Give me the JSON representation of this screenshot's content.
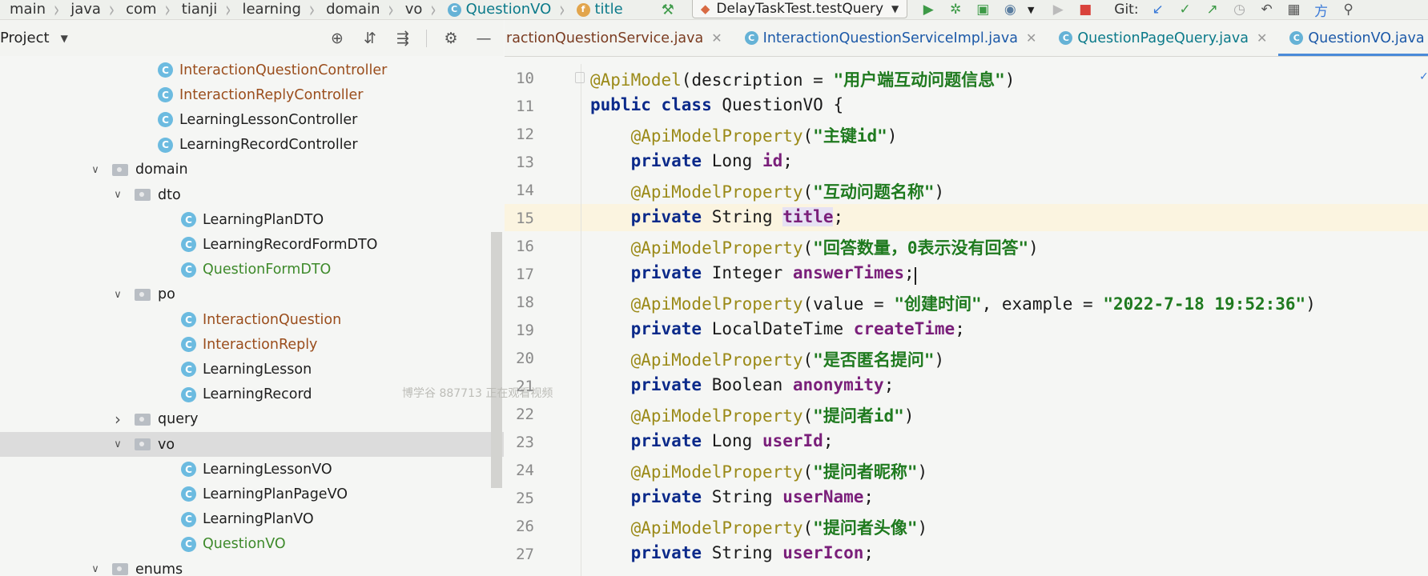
{
  "breadcrumb": [
    {
      "label": "main",
      "type": "dir"
    },
    {
      "label": "java",
      "type": "dir"
    },
    {
      "label": "com",
      "type": "dir"
    },
    {
      "label": "tianji",
      "type": "dir"
    },
    {
      "label": "learning",
      "type": "dir"
    },
    {
      "label": "domain",
      "type": "dir"
    },
    {
      "label": "vo",
      "type": "dir"
    },
    {
      "label": "QuestionVO",
      "type": "class"
    },
    {
      "label": "title",
      "type": "field"
    }
  ],
  "toolbar": {
    "run_config": "DelayTaskTest.testQuery",
    "git_label": "Git:"
  },
  "project_panel": {
    "title": "Project",
    "tree": [
      {
        "label": "InteractionQuestionController",
        "kind": "class",
        "depth": 3,
        "status": "modified"
      },
      {
        "label": "InteractionReplyController",
        "kind": "class",
        "depth": 3,
        "status": "modified"
      },
      {
        "label": "LearningLessonController",
        "kind": "class",
        "depth": 3,
        "status": "default"
      },
      {
        "label": "LearningRecordController",
        "kind": "class",
        "depth": 3,
        "status": "default"
      },
      {
        "label": "domain",
        "kind": "folder",
        "depth": 1,
        "expanded": true,
        "status": "default"
      },
      {
        "label": "dto",
        "kind": "folder",
        "depth": 2,
        "expanded": true,
        "status": "default"
      },
      {
        "label": "LearningPlanDTO",
        "kind": "class",
        "depth": 4,
        "status": "default"
      },
      {
        "label": "LearningRecordFormDTO",
        "kind": "class",
        "depth": 4,
        "status": "default"
      },
      {
        "label": "QuestionFormDTO",
        "kind": "class",
        "depth": 4,
        "status": "new"
      },
      {
        "label": "po",
        "kind": "folder",
        "depth": 2,
        "expanded": true,
        "status": "default"
      },
      {
        "label": "InteractionQuestion",
        "kind": "class",
        "depth": 4,
        "status": "modified"
      },
      {
        "label": "InteractionReply",
        "kind": "class",
        "depth": 4,
        "status": "modified"
      },
      {
        "label": "LearningLesson",
        "kind": "class",
        "depth": 4,
        "status": "default"
      },
      {
        "label": "LearningRecord",
        "kind": "class",
        "depth": 4,
        "status": "default"
      },
      {
        "label": "query",
        "kind": "folder",
        "depth": 2,
        "expanded": false,
        "status": "default"
      },
      {
        "label": "vo",
        "kind": "folder",
        "depth": 2,
        "expanded": true,
        "status": "default",
        "selected": true
      },
      {
        "label": "LearningLessonVO",
        "kind": "class",
        "depth": 4,
        "status": "default"
      },
      {
        "label": "LearningPlanPageVO",
        "kind": "class",
        "depth": 4,
        "status": "default"
      },
      {
        "label": "LearningPlanVO",
        "kind": "class",
        "depth": 4,
        "status": "default"
      },
      {
        "label": "QuestionVO",
        "kind": "class",
        "depth": 4,
        "status": "new"
      },
      {
        "label": "enums",
        "kind": "folder",
        "depth": 1,
        "expanded": true,
        "status": "default"
      }
    ]
  },
  "watermark": "博学谷 887713 正在观看视频",
  "editor": {
    "tabs": [
      {
        "label": "ractionQuestionService.java",
        "icon": false,
        "closable": true,
        "style": "first"
      },
      {
        "label": "InteractionQuestionServiceImpl.java",
        "icon": true,
        "closable": true,
        "style": "plain"
      },
      {
        "label": "QuestionPageQuery.java",
        "icon": true,
        "closable": true,
        "style": "mod"
      },
      {
        "label": "QuestionVO.java",
        "icon": true,
        "closable": true,
        "style": "active"
      }
    ],
    "lines": [
      {
        "n": "10",
        "segs": [
          {
            "t": "@ApiModel",
            "c": "ann"
          },
          {
            "t": "(description = ",
            "c": ""
          },
          {
            "t": "\"用户端互动问题信息\"",
            "c": "str"
          },
          {
            "t": ")",
            "c": ""
          }
        ]
      },
      {
        "n": "11",
        "segs": [
          {
            "t": "public class ",
            "c": "kw"
          },
          {
            "t": "QuestionVO {",
            "c": ""
          }
        ]
      },
      {
        "n": "12",
        "segs": [
          {
            "t": "    ",
            "c": ""
          },
          {
            "t": "@ApiModelProperty",
            "c": "ann"
          },
          {
            "t": "(",
            "c": ""
          },
          {
            "t": "\"主键id\"",
            "c": "str"
          },
          {
            "t": ")",
            "c": ""
          }
        ]
      },
      {
        "n": "13",
        "segs": [
          {
            "t": "    ",
            "c": ""
          },
          {
            "t": "private ",
            "c": "kw"
          },
          {
            "t": "Long ",
            "c": ""
          },
          {
            "t": "id",
            "c": "fld"
          },
          {
            "t": ";",
            "c": ""
          }
        ]
      },
      {
        "n": "14",
        "segs": [
          {
            "t": "    ",
            "c": ""
          },
          {
            "t": "@ApiModelProperty",
            "c": "ann"
          },
          {
            "t": "(",
            "c": ""
          },
          {
            "t": "\"互动问题名称\"",
            "c": "str"
          },
          {
            "t": ")",
            "c": ""
          }
        ]
      },
      {
        "n": "15",
        "segs": [
          {
            "t": "    ",
            "c": ""
          },
          {
            "t": "private ",
            "c": "kw"
          },
          {
            "t": "String ",
            "c": ""
          },
          {
            "t": "title",
            "c": "fld hl"
          },
          {
            "t": ";",
            "c": ""
          }
        ]
      },
      {
        "n": "16",
        "segs": [
          {
            "t": "    ",
            "c": ""
          },
          {
            "t": "@ApiModelProperty",
            "c": "ann"
          },
          {
            "t": "(",
            "c": ""
          },
          {
            "t": "\"回答数量，0表示没有回答\"",
            "c": "str"
          },
          {
            "t": ")",
            "c": ""
          }
        ]
      },
      {
        "n": "17",
        "segs": [
          {
            "t": "    ",
            "c": ""
          },
          {
            "t": "private ",
            "c": "kw"
          },
          {
            "t": "Integer ",
            "c": ""
          },
          {
            "t": "answerTimes",
            "c": "fld"
          },
          {
            "t": ";",
            "c": ""
          }
        ]
      },
      {
        "n": "18",
        "segs": [
          {
            "t": "    ",
            "c": ""
          },
          {
            "t": "@ApiModelProperty",
            "c": "ann"
          },
          {
            "t": "(value = ",
            "c": ""
          },
          {
            "t": "\"创建时间\"",
            "c": "str"
          },
          {
            "t": ", example = ",
            "c": ""
          },
          {
            "t": "\"2022-7-18 19:52:36\"",
            "c": "str"
          },
          {
            "t": ")",
            "c": ""
          }
        ]
      },
      {
        "n": "19",
        "segs": [
          {
            "t": "    ",
            "c": ""
          },
          {
            "t": "private ",
            "c": "kw"
          },
          {
            "t": "LocalDateTime ",
            "c": ""
          },
          {
            "t": "createTime",
            "c": "fld"
          },
          {
            "t": ";",
            "c": ""
          }
        ]
      },
      {
        "n": "20",
        "segs": [
          {
            "t": "    ",
            "c": ""
          },
          {
            "t": "@ApiModelProperty",
            "c": "ann"
          },
          {
            "t": "(",
            "c": ""
          },
          {
            "t": "\"是否匿名提问\"",
            "c": "str"
          },
          {
            "t": ")",
            "c": ""
          }
        ]
      },
      {
        "n": "21",
        "segs": [
          {
            "t": "    ",
            "c": ""
          },
          {
            "t": "private ",
            "c": "kw"
          },
          {
            "t": "Boolean ",
            "c": ""
          },
          {
            "t": "anonymity",
            "c": "fld"
          },
          {
            "t": ";",
            "c": ""
          }
        ]
      },
      {
        "n": "22",
        "segs": [
          {
            "t": "    ",
            "c": ""
          },
          {
            "t": "@ApiModelProperty",
            "c": "ann"
          },
          {
            "t": "(",
            "c": ""
          },
          {
            "t": "\"提问者id\"",
            "c": "str"
          },
          {
            "t": ")",
            "c": ""
          }
        ]
      },
      {
        "n": "23",
        "segs": [
          {
            "t": "    ",
            "c": ""
          },
          {
            "t": "private ",
            "c": "kw"
          },
          {
            "t": "Long ",
            "c": ""
          },
          {
            "t": "userId",
            "c": "fld"
          },
          {
            "t": ";",
            "c": ""
          }
        ]
      },
      {
        "n": "24",
        "segs": [
          {
            "t": "    ",
            "c": ""
          },
          {
            "t": "@ApiModelProperty",
            "c": "ann"
          },
          {
            "t": "(",
            "c": ""
          },
          {
            "t": "\"提问者昵称\"",
            "c": "str"
          },
          {
            "t": ")",
            "c": ""
          }
        ]
      },
      {
        "n": "25",
        "segs": [
          {
            "t": "    ",
            "c": ""
          },
          {
            "t": "private ",
            "c": "kw"
          },
          {
            "t": "String ",
            "c": ""
          },
          {
            "t": "userName",
            "c": "fld"
          },
          {
            "t": ";",
            "c": ""
          }
        ]
      },
      {
        "n": "26",
        "segs": [
          {
            "t": "    ",
            "c": ""
          },
          {
            "t": "@ApiModelProperty",
            "c": "ann"
          },
          {
            "t": "(",
            "c": ""
          },
          {
            "t": "\"提问者头像\"",
            "c": "str"
          },
          {
            "t": ")",
            "c": ""
          }
        ]
      },
      {
        "n": "27",
        "segs": [
          {
            "t": "    ",
            "c": ""
          },
          {
            "t": "private ",
            "c": "kw"
          },
          {
            "t": "String ",
            "c": ""
          },
          {
            "t": "userIcon",
            "c": "fld"
          },
          {
            "t": ";",
            "c": ""
          }
        ]
      }
    ]
  }
}
